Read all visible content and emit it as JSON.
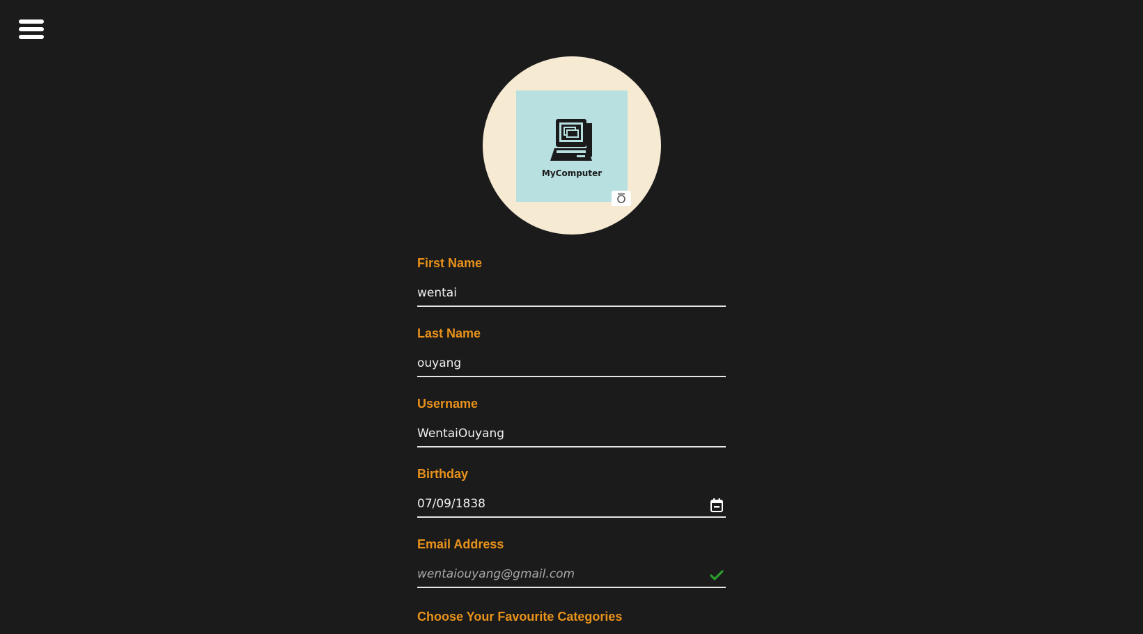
{
  "menu": {
    "icon": "hamburger-menu-icon"
  },
  "avatar": {
    "caption": "MyComputer",
    "image_icon": "computer-icon",
    "camera_icon": "camera-icon",
    "colors": {
      "circle": "#f6ead3",
      "tile": "#b8e0e0"
    }
  },
  "form": {
    "first_name": {
      "label": "First Name",
      "value": "wentai"
    },
    "last_name": {
      "label": "Last Name",
      "value": "ouyang"
    },
    "username": {
      "label": "Username",
      "value": "WentaiOuyang"
    },
    "birthday": {
      "label": "Birthday",
      "value": "07/09/1838",
      "icon": "calendar-icon"
    },
    "email": {
      "label": "Email Address",
      "placeholder": "wentaiouyang@gmail.com",
      "icon": "checkmark-icon",
      "valid": true
    }
  },
  "categories": {
    "label": "Choose Your Favourite Categories"
  },
  "colors": {
    "background": "#1b1b1b",
    "accent": "#e8921a",
    "valid": "#2aa02a"
  }
}
